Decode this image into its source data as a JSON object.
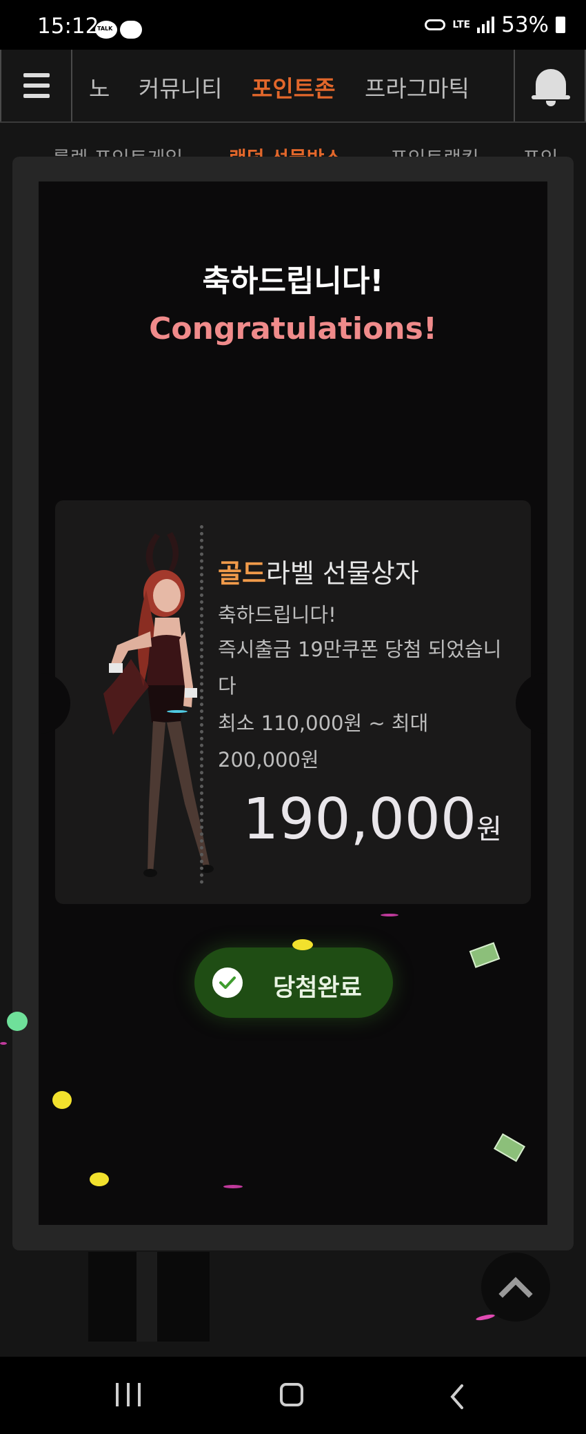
{
  "status_bar": {
    "time": "15:12",
    "talk_badge": "TALK",
    "network": "LTE",
    "battery": "53%"
  },
  "nav": {
    "tabs": [
      "노",
      "커뮤니티",
      "포인트존",
      "프라그마틱"
    ],
    "active_tab": "포인트존"
  },
  "subnav": {
    "tabs": [
      "룰렛 포인트게임",
      "랜덤 선물박스",
      "포인트랭킹",
      "포인"
    ]
  },
  "modal": {
    "title": "축하드립니다!",
    "subtitle": "Congratulations!",
    "prize": {
      "label_highlight": "골드",
      "label_rest": "라벨 선물상자",
      "line1": "축하드립니다!",
      "line2": "즉시출금 19만쿠폰 당첨 되었습니다",
      "line3": "최소 110,000원 ~ 최대 200,000원",
      "amount": "190,000",
      "currency": "원"
    },
    "result_button": "당첨완료"
  },
  "colors": {
    "accent_orange": "#e2672b",
    "gold": "#f09a4a",
    "congrats_pink": "#f08b8b",
    "success_green": "#1f4d14"
  },
  "icons": [
    "menu-icon",
    "bell-icon",
    "check-icon",
    "chevron-up-icon",
    "money-icon"
  ]
}
